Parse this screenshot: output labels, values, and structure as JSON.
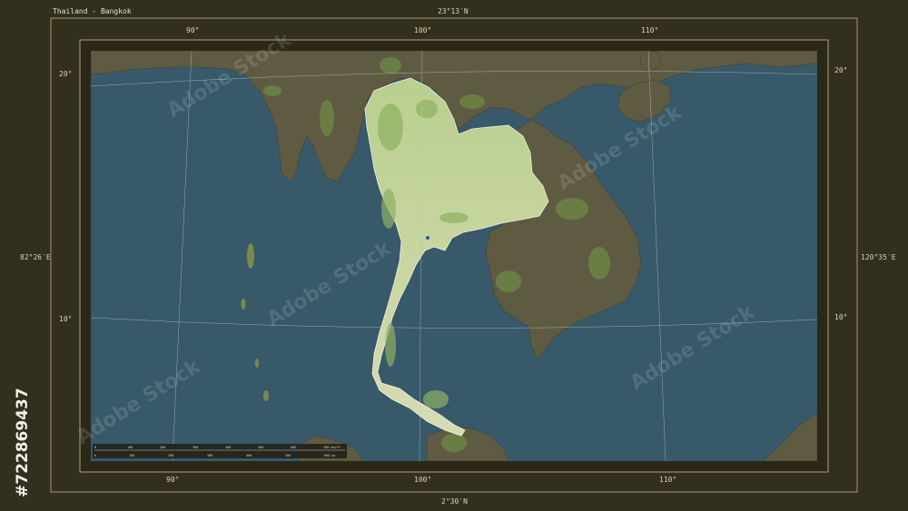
{
  "map": {
    "title": "Thailand - Bangkok",
    "top_lat": "23°13′N",
    "bottom_lat": "2°30′N",
    "left_lon": "82°26′E",
    "right_lon": "120°35′E",
    "grid_top": [
      "90°",
      "100°",
      "110°"
    ],
    "grid_bottom": [
      "90°",
      "100°",
      "110°"
    ],
    "grid_left": [
      "20°",
      "10°"
    ],
    "grid_right": [
      "20°",
      "10°"
    ],
    "scale_top": [
      "0",
      "100",
      "200",
      "300",
      "400",
      "500",
      "600",
      "700 km/ft"
    ],
    "scale_bottom": [
      "0",
      "100",
      "200",
      "300",
      "400",
      "500",
      "600 mi"
    ],
    "colors": {
      "frame": "#332f1d",
      "ocean": "#37596a",
      "land": "#5a5740",
      "highlight": "#c7d4a4",
      "forest": "#6d8a45"
    }
  },
  "watermark": {
    "text": "Adobe Stock",
    "stock_id": "#722869437"
  }
}
